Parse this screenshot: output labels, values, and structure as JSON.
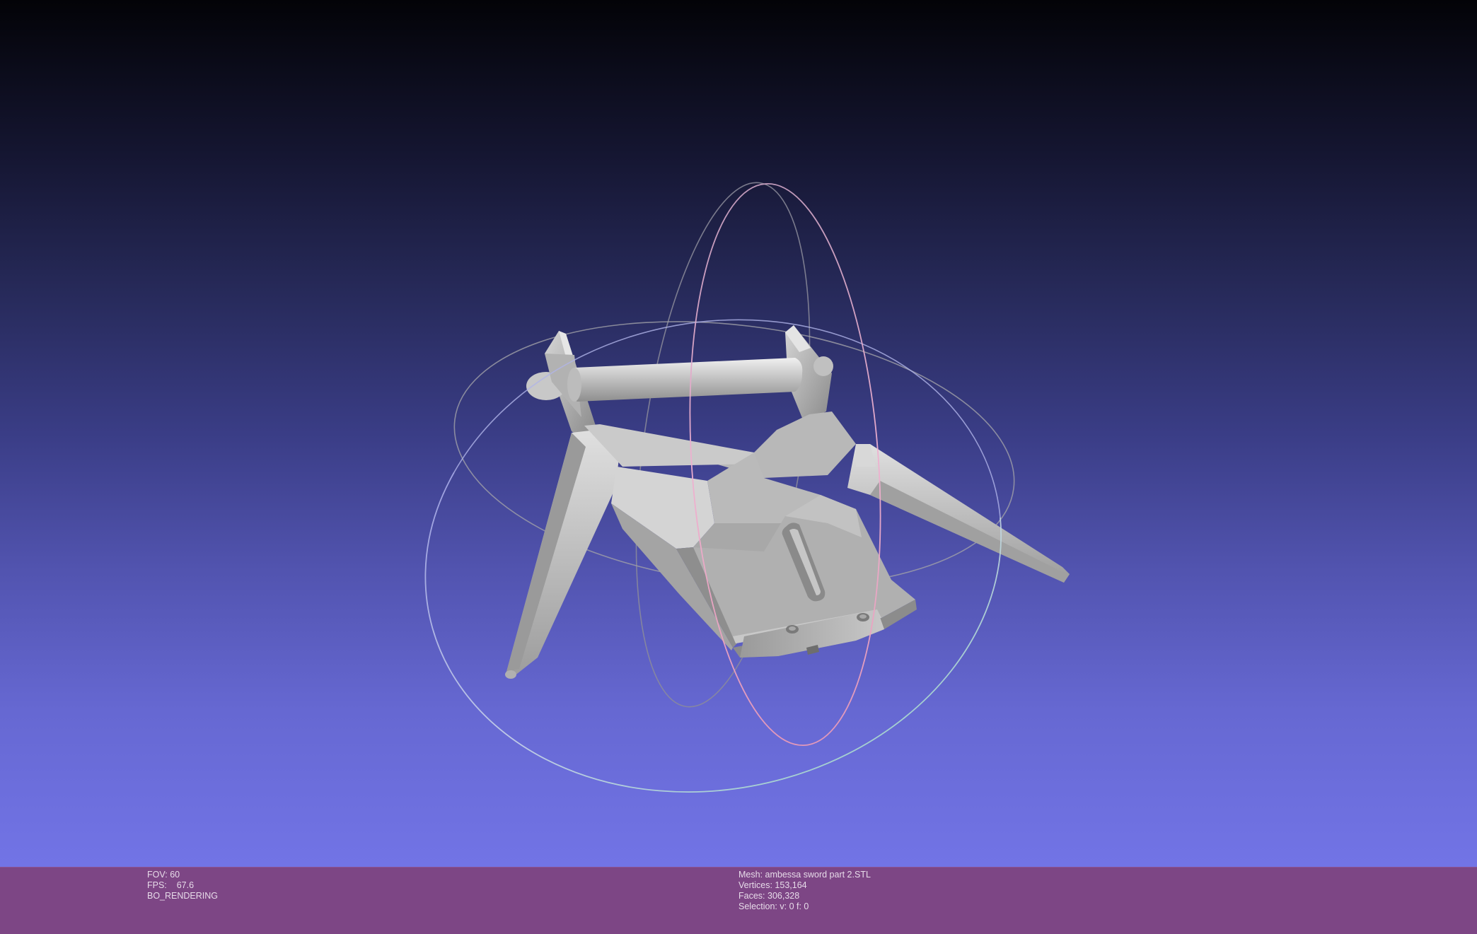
{
  "viewer": {
    "background_top": "#030307",
    "background_bottom": "#7274e6",
    "trackball_colors": {
      "horizontal": "#a8c0e0",
      "vertical": "#e8a8c8",
      "side": "#a0a0a0"
    }
  },
  "scene": {
    "model": "sword-guard-mesh",
    "gizmo": "trackball"
  },
  "infobar": {
    "left": {
      "fov_label": "FOV:",
      "fov_value": "60",
      "fps_label": "FPS:",
      "fps_value": "67.6",
      "render_mode": "BO_RENDERING"
    },
    "right": {
      "mesh_label": "Mesh:",
      "mesh_value": "ambessa sword part 2.STL",
      "vertices_label": "Vertices:",
      "vertices_value": "153,164",
      "faces_label": "Faces:",
      "faces_value": "306,328",
      "selection_label": "Selection:",
      "selection_value": "v: 0 f: 0"
    }
  }
}
